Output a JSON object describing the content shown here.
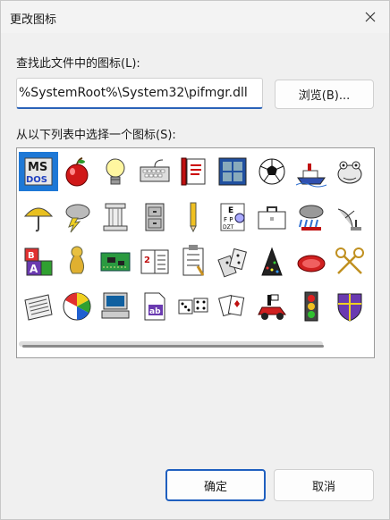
{
  "dialog": {
    "title": "更改图标",
    "file_label": "查找此文件中的图标(L):",
    "file_value": "%SystemRoot%\\System32\\pifmgr.dll",
    "browse_label": "浏览(B)...",
    "icons_label": "从以下列表中选择一个图标(S):",
    "ok_label": "确定",
    "cancel_label": "取消"
  },
  "icons": [
    {
      "name": "ms-dos-icon",
      "selected": true,
      "ms": "MS",
      "dos": "DOS"
    },
    {
      "name": "apple-icon"
    },
    {
      "name": "lightbulb-icon"
    },
    {
      "name": "keyboard-icon"
    },
    {
      "name": "pen-document-icon"
    },
    {
      "name": "window-frame-icon"
    },
    {
      "name": "soccer-ball-icon"
    },
    {
      "name": "ship-icon"
    },
    {
      "name": "frog-icon"
    },
    {
      "name": "umbrella-icon"
    },
    {
      "name": "storm-cloud-icon"
    },
    {
      "name": "column-icon"
    },
    {
      "name": "file-cabinet-icon"
    },
    {
      "name": "pencil-icon"
    },
    {
      "name": "eye-chart-icon"
    },
    {
      "name": "briefcase-icon"
    },
    {
      "name": "stormy-sky-icon"
    },
    {
      "name": "satellite-dish-icon"
    },
    {
      "name": "abc-blocks-icon"
    },
    {
      "name": "tuba-icon"
    },
    {
      "name": "circuit-board-icon"
    },
    {
      "name": "calendar-book-icon"
    },
    {
      "name": "checklist-icon"
    },
    {
      "name": "dominoes-icon"
    },
    {
      "name": "party-hat-icon"
    },
    {
      "name": "rubber-raft-icon"
    },
    {
      "name": "crossed-keys-icon"
    },
    {
      "name": "newspaper-icon"
    },
    {
      "name": "beach-ball-icon"
    },
    {
      "name": "computer-icon"
    },
    {
      "name": "ab-document-icon"
    },
    {
      "name": "dice-icon"
    },
    {
      "name": "playing-cards-icon"
    },
    {
      "name": "race-car-icon"
    },
    {
      "name": "traffic-light-icon"
    },
    {
      "name": "shield-icon"
    }
  ]
}
